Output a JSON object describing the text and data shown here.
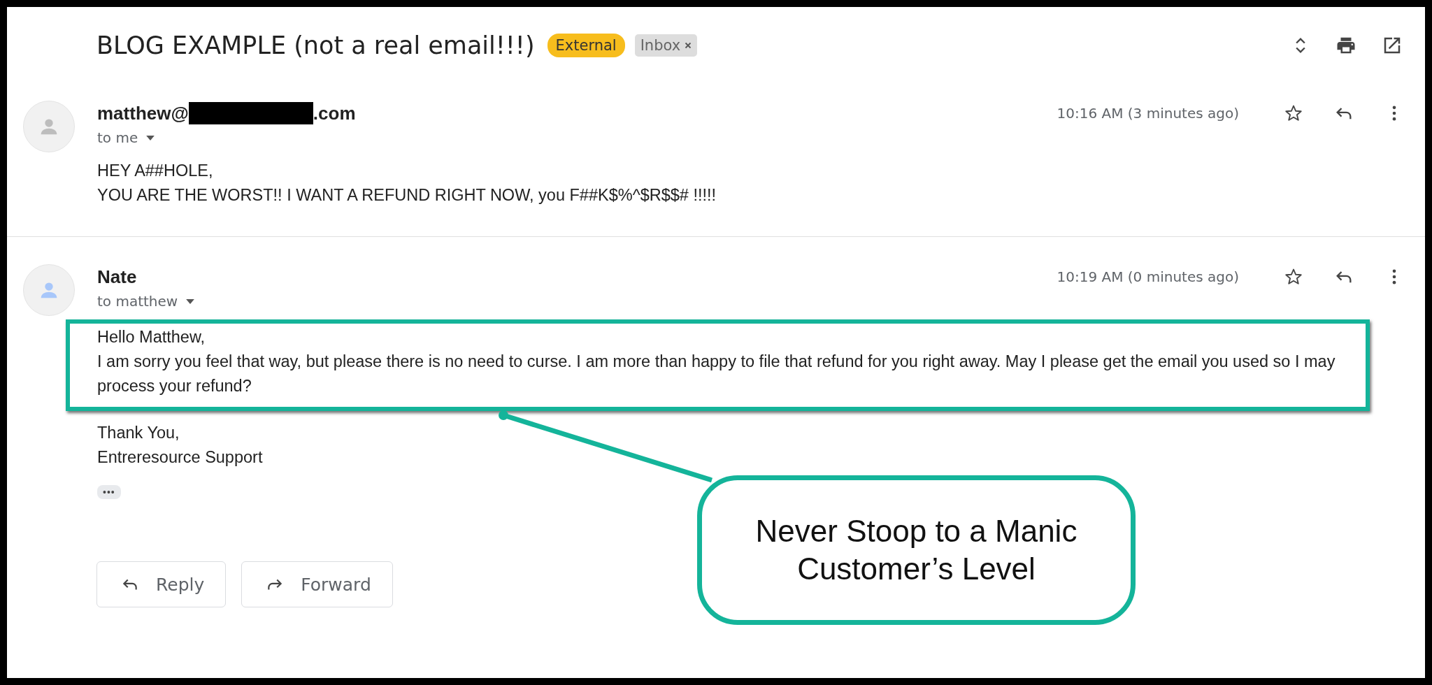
{
  "subject": "BLOG EXAMPLE (not a real email!!!)",
  "labels": [
    {
      "text": "External",
      "color": "#f7bd1d",
      "removable": false
    },
    {
      "text": "Inbox",
      "color": "#dddddd",
      "removable": true
    }
  ],
  "messages": [
    {
      "sender_start": "matthew@",
      "redacted": true,
      "sender_end": ".com",
      "recipient": "to me",
      "time": "10:16 AM (3 minutes ago)",
      "starred": false,
      "color": "#bdbdbd",
      "blocks": [
        {
          "highlighted": false,
          "lines": [
            "HEY A##HOLE,",
            "YOU ARE THE WORST!! I WANT A REFUND RIGHT NOW, you F##K$%^$R$$# !!!!!"
          ]
        }
      ]
    },
    {
      "sender_start": "Nate",
      "redacted": false,
      "recipient": "to matthew",
      "time": "10:19 AM (0 minutes ago)",
      "starred": false,
      "color": "#a8c7fa",
      "blocks": [
        {
          "highlighted": true,
          "lines": [
            "Hello Matthew,",
            "I am sorry you feel that way, but please there is no need to curse. I am more than happy to file that refund for you right away. May I please get the email you used so I may process your refund?"
          ]
        },
        {
          "highlighted": false,
          "lines": [
            "Thank You,",
            "Entreresource Support"
          ]
        }
      ],
      "trimmed": "•••"
    }
  ],
  "actions": [
    {
      "kind": "reply",
      "label": "Reply"
    },
    {
      "kind": "forward",
      "label": "Forward"
    }
  ],
  "callout": {
    "text": "Never Stoop to a Manic Customer’s Level"
  }
}
